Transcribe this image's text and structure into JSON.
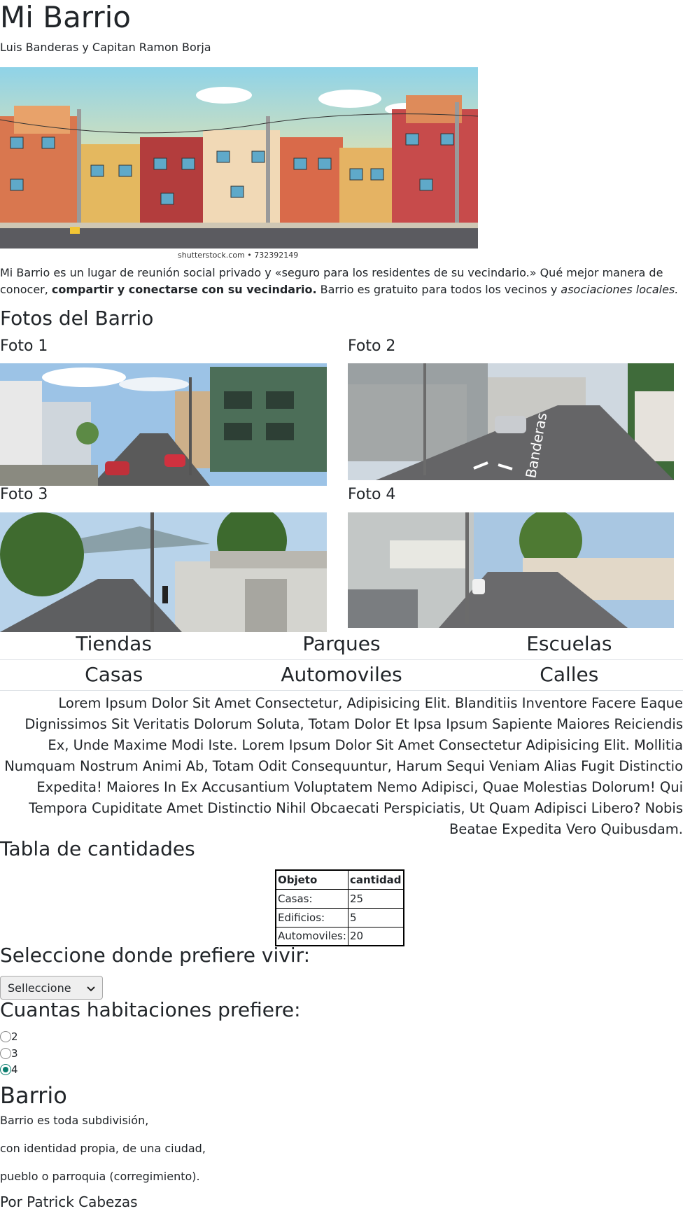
{
  "header": {
    "title": "Mi Barrio",
    "subtitle": "Luis Banderas y Capitan Ramon Borja",
    "image_credit": "shutterstock.com • 732392149"
  },
  "intro": {
    "part1": "Mi Barrio es un lugar de reunión social privado y «seguro para los residentes de su vecindario.» Qué mejor manera de conocer, ",
    "bold": "compartir y conectarse con su vecindario.",
    "part2": " Barrio es gratuito para todos los vecinos y ",
    "italic": "asociaciones locales."
  },
  "photos": {
    "heading": "Fotos del Barrio",
    "items": [
      {
        "label": "Foto 1"
      },
      {
        "label": "Foto 2"
      },
      {
        "label": "Foto 3"
      },
      {
        "label": "Foto 4"
      }
    ],
    "street_sign": "Banderas"
  },
  "nav": {
    "row1": [
      "Tiendas",
      "Parques",
      "Escuelas"
    ],
    "row2": [
      "Casas",
      "Automoviles",
      "Calles"
    ]
  },
  "lorem": "Lorem Ipsum Dolor Sit Amet Consectetur, Adipisicing Elit. Blanditiis Inventore Facere Eaque Dignissimos Sit Veritatis Dolorum Soluta, Totam Dolor Et Ipsa Ipsum Sapiente Maiores Reiciendis Ex, Unde Maxime Modi Iste. Lorem Ipsum Dolor Sit Amet Consectetur Adipisicing Elit. Mollitia Numquam Nostrum Animi Ab, Totam Odit Consequuntur, Harum Sequi Veniam Alias Fugit Distinctio Expedita! Maiores In Ex Accusantium Voluptatem Nemo Adipisci, Quae Molestias Dolorum! Qui Tempora Cupiditate Amet Distinctio Nihil Obcaecati Perspiciatis, Ut Quam Adipisci Libero? Nobis Beatae Expedita Vero Quibusdam.",
  "table": {
    "heading": "Tabla de cantidades",
    "headers": [
      "Objeto",
      "cantidad"
    ],
    "rows": [
      [
        "Casas:",
        "25"
      ],
      [
        "Edificios:",
        "5"
      ],
      [
        "Automoviles:",
        "20"
      ]
    ]
  },
  "form": {
    "select_heading": "Seleccione donde prefiere vivir:",
    "select_value": "Selleccione",
    "radio_heading": "Cuantas habitaciones prefiere:",
    "radio_options": [
      "2",
      "3",
      "4"
    ],
    "radio_selected": "4"
  },
  "barrio": {
    "heading": "Barrio",
    "lines": [
      "Barrio es toda subdivisión,",
      "con identidad propia, de una ciudad,",
      "pueblo o parroquia (corregimiento)."
    ],
    "author": "Por Patrick Cabezas"
  },
  "colors": {
    "accent_radio": "#0a7d6e",
    "divider": "#dee2e6"
  }
}
